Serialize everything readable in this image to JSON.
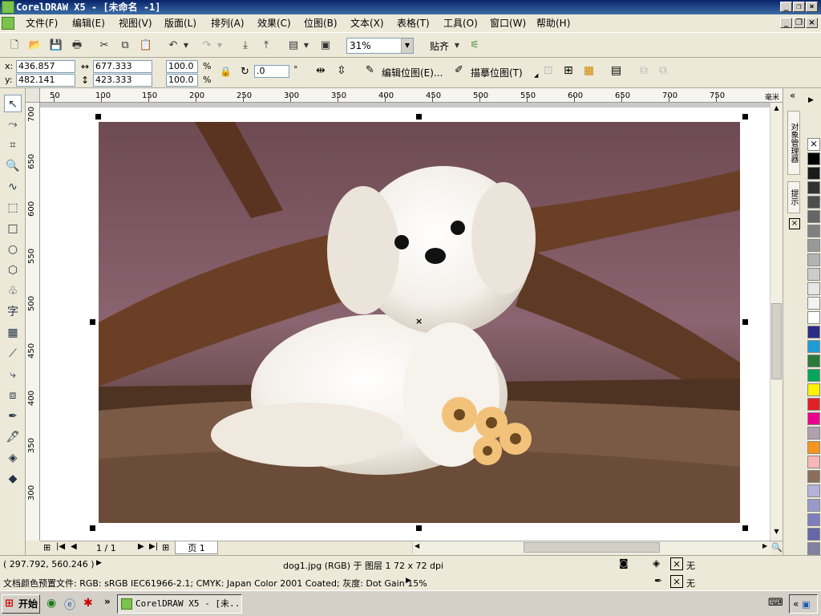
{
  "window": {
    "title": "CorelDRAW X5 - [未命名 -1]"
  },
  "menu": {
    "items": [
      "文件(F)",
      "编辑(E)",
      "视图(V)",
      "版面(L)",
      "排列(A)",
      "效果(C)",
      "位图(B)",
      "文本(X)",
      "表格(T)",
      "工具(O)",
      "窗口(W)",
      "帮助(H)"
    ]
  },
  "toolbar": {
    "zoom": "31%",
    "snap_label": "贴齐"
  },
  "property_bar": {
    "x_label": "x:",
    "x_value": "436.857 mm",
    "y_label": "y:",
    "y_value": "482.141 mm",
    "width_value": "677.333 mm",
    "height_value": "423.333 mm",
    "scale_w": "100.0",
    "scale_h": "100.0",
    "percent": "%",
    "rotation": ".0",
    "degree": "°",
    "edit_bitmap": "编辑位图(E)...",
    "trace_bitmap": "描摹位图(T)"
  },
  "ruler_top": {
    "ticks": [
      "50",
      "100",
      "150",
      "200",
      "250",
      "300",
      "350",
      "400",
      "450",
      "500",
      "550",
      "600",
      "650",
      "700",
      "750"
    ],
    "unit": "毫米"
  },
  "ruler_left": {
    "ticks": [
      "700",
      "650",
      "600",
      "550",
      "500",
      "450",
      "400",
      "350",
      "300"
    ]
  },
  "page_nav": {
    "count": "1 / 1",
    "tab": "页 1"
  },
  "dockers": {
    "tab1": "对象管理器",
    "tab2": "提示"
  },
  "palette": {
    "colors": [
      "#ffffff",
      "#000000",
      "#1a1a1a",
      "#333333",
      "#4d4d4d",
      "#666666",
      "#808080",
      "#999999",
      "#b3b3b3",
      "#cccccc",
      "#e6e6e6",
      "#f2f2f2",
      "#ffffff",
      "#2b2b8a",
      "#1f9bd7",
      "#2a7a3a",
      "#00a65a",
      "#fff200",
      "#e21f26",
      "#ec008c",
      "#b0a0b0",
      "#f7941d",
      "#f9b6b6",
      "#8c6e5a",
      "#b3b3d9",
      "#9999cc",
      "#7f7fbf",
      "#6666aa",
      "#8080a0"
    ]
  },
  "status": {
    "coords": "( 297.792, 560.246 )",
    "object_info": "dog1.jpg (RGB) 于 图层 1 72 x 72 dpi",
    "fill_none": "无",
    "outline_none": "无",
    "color_profile": "文档颜色预置文件: RGB: sRGB IEC61966-2.1; CMYK: Japan Color 2001 Coated; 灰度: Dot Gain 15%"
  },
  "taskbar": {
    "start": "开始",
    "task": "CorelDRAW X5 - [未..."
  }
}
